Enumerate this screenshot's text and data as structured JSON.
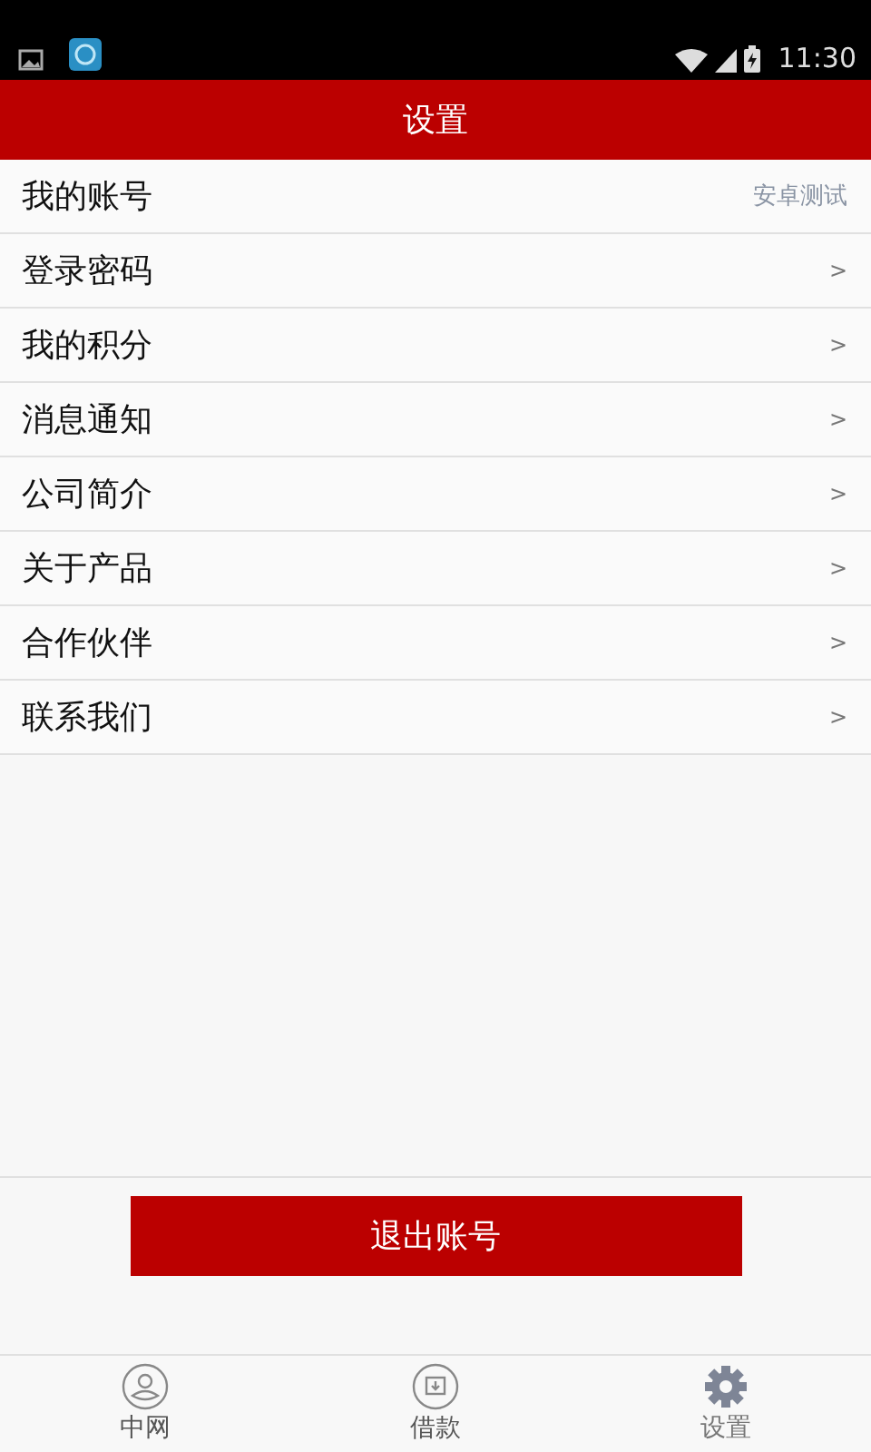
{
  "status_bar": {
    "time": "11:30"
  },
  "header": {
    "title": "设置"
  },
  "items": [
    {
      "label": "我的账号",
      "value": "安卓测试"
    },
    {
      "label": "登录密码",
      "arrow": ">"
    },
    {
      "label": "我的积分",
      "arrow": ">"
    },
    {
      "label": "消息通知",
      "arrow": ">"
    },
    {
      "label": "公司简介",
      "arrow": ">"
    },
    {
      "label": "关于产品",
      "arrow": ">"
    },
    {
      "label": "合作伙伴",
      "arrow": ">"
    },
    {
      "label": "联系我们",
      "arrow": ">"
    }
  ],
  "logout_button": "退出账号",
  "tabs": [
    {
      "label": "中网",
      "kind": "person",
      "selected": false
    },
    {
      "label": "借款",
      "kind": "loan",
      "selected": false
    },
    {
      "label": "设置",
      "kind": "gear",
      "selected": true
    }
  ]
}
